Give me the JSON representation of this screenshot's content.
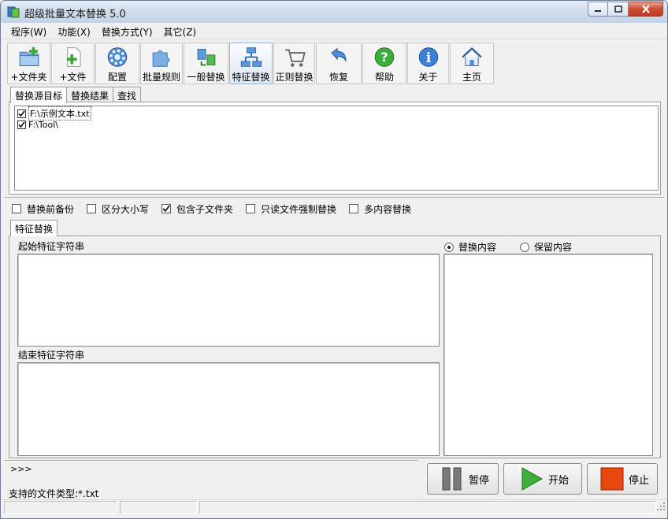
{
  "window": {
    "title": "超级批量文本替换 5.0"
  },
  "menu": [
    "程序(W)",
    "功能(X)",
    "替换方式(Y)",
    "其它(Z)"
  ],
  "toolbar": [
    {
      "label": "+文件夹",
      "icon": "add-folder-icon"
    },
    {
      "label": "+文件",
      "icon": "add-file-icon"
    },
    {
      "label": "配置",
      "icon": "settings-gear-icon"
    },
    {
      "label": "批量规则",
      "icon": "puzzle-icon"
    },
    {
      "label": "一般替换",
      "icon": "replace-arrows-icon"
    },
    {
      "label": "特征替换",
      "icon": "network-icon"
    },
    {
      "label": "正则替换",
      "icon": "cart-icon"
    },
    {
      "label": "恢复",
      "icon": "undo-arrow-icon"
    },
    {
      "label": "帮助",
      "icon": "help-icon"
    },
    {
      "label": "关于",
      "icon": "info-icon"
    },
    {
      "label": "主页",
      "icon": "home-icon"
    }
  ],
  "toolbar_active": "特征替换",
  "tabs": [
    "替换源目标",
    "替换结果",
    "查找"
  ],
  "files": [
    {
      "path": "F:\\示例文本.txt",
      "checked": true
    },
    {
      "path": "F:\\Tool\\",
      "checked": true
    }
  ],
  "options": [
    {
      "label": "替换前备份",
      "checked": false
    },
    {
      "label": "区分大小写",
      "checked": false
    },
    {
      "label": "包含子文件夹",
      "checked": true
    },
    {
      "label": "只读文件强制替换",
      "checked": false
    },
    {
      "label": "多内容替换",
      "checked": false
    }
  ],
  "feature_tab": "特征替换",
  "start_label": "起始特征字符串",
  "end_label": "结束特征字符串",
  "radio": {
    "replace": "替换内容",
    "keep": "保留内容",
    "selected": "replace"
  },
  "prompt": ">>>",
  "supported_types": "支持的文件类型:*.txt",
  "buttons": {
    "pause": "暂停",
    "start": "开始",
    "stop": "停止"
  },
  "colors": {
    "start_green": "#3fae3a",
    "stop_orange": "#e8480f"
  }
}
